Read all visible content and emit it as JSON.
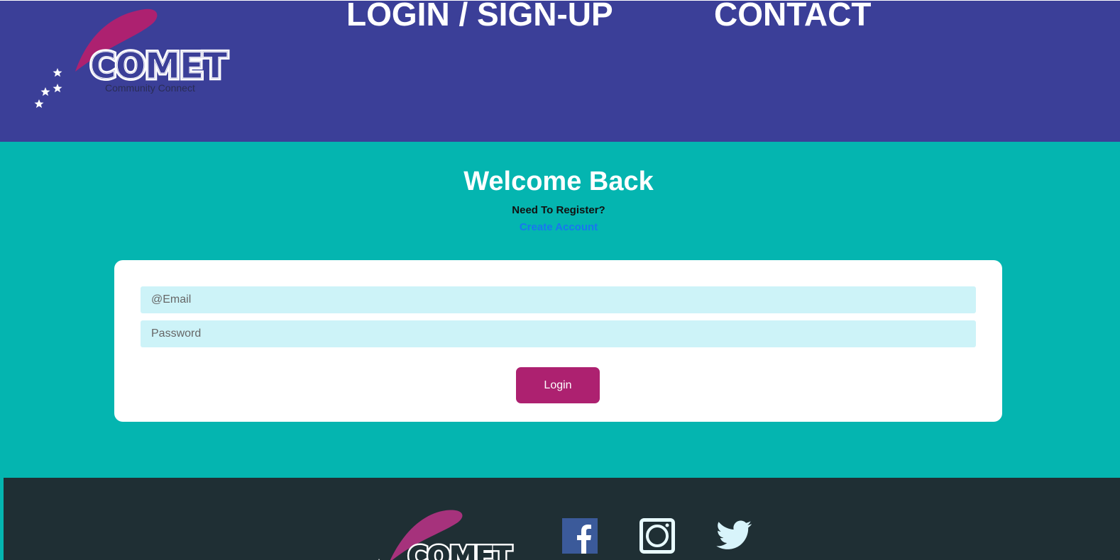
{
  "header": {
    "logo": {
      "name": "COMET",
      "tagline": "Community Connect"
    },
    "nav": {
      "login_signup": "LOGIN / SIGN-UP",
      "contact": "CONTACT"
    }
  },
  "main": {
    "title": "Welcome Back",
    "register_prompt": "Need To Register?",
    "create_account_link": "Create Account",
    "form": {
      "email_placeholder": "@Email",
      "password_placeholder": "Password",
      "login_button": "Login"
    }
  },
  "footer": {
    "logo_name": "COMET",
    "social_icons": [
      "facebook-icon",
      "instagram-icon",
      "twitter-icon"
    ]
  },
  "colors": {
    "header_bg": "#3b3f98",
    "main_bg": "#04b5b0",
    "footer_bg": "#1f2f34",
    "accent_magenta": "#ad2170",
    "input_bg": "#cdf3f8",
    "link_blue": "#1976f0"
  }
}
